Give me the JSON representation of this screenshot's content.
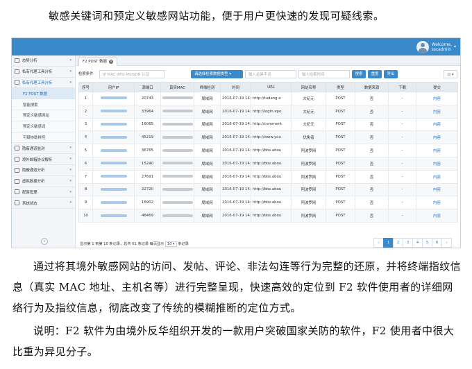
{
  "doc": {
    "para_top": "敏感关键词和预定义敏感网站功能，便于用户更快速的发现可疑线索。",
    "para_mid": "通过将其境外敏感网站的访问、发帖、评论、非法勾连等行为完整的还原，并将终端指纹信息（真实 MAC 地址、主机名等）进行完整呈现，快速高效的定位到 F2 软件使用者的详细网络行为及指纹信息，彻底改变了传统的模糊推断的定位方式。",
    "para_note": "说明：F2 软件为由境外反华组织开发的一款用户突破国家关防的软件，F2 使用者中很大比重为异见分子。"
  },
  "ui": {
    "user": {
      "line1": "Welcome,",
      "line2": "sscadmin"
    },
    "sidebar": [
      {
        "label": "态势分析",
        "type": "top"
      },
      {
        "label": "私有代理工具分析",
        "type": "top"
      },
      {
        "label": "私有代理工具分析",
        "type": "expanded"
      },
      {
        "label": "F2 POST 数据",
        "type": "active"
      },
      {
        "label": "智能搜索",
        "type": "sub"
      },
      {
        "label": "预定义敏感网站",
        "type": "sub"
      },
      {
        "label": "预定义敏感词",
        "type": "sub"
      },
      {
        "label": "可疑协助排控",
        "type": "sub"
      },
      {
        "label": "隐蔽通道监测",
        "type": "top"
      },
      {
        "label": "境外邮箱协议解析",
        "type": "top"
      },
      {
        "label": "隐蔽通道分析",
        "type": "top"
      },
      {
        "label": "虚拟数据分析",
        "type": "top"
      },
      {
        "label": "配置管理",
        "type": "top"
      },
      {
        "label": "系统状态",
        "type": "top"
      }
    ],
    "tab": "F2 POST 数据",
    "filters": {
      "label": "检索条件",
      "ip_placeholder": "IP MAC IMSI MSISDN 认证",
      "select": "请选择检索数据类型",
      "kw_placeholder": "输入关键字词",
      "time_placeholder": "输入检索时间",
      "search": "搜索",
      "reset": "重置",
      "export": "导出",
      "gear": "☷ ▾"
    },
    "headers": [
      "序号",
      "用户IP",
      "源端口",
      "真实MAC",
      "终端检测",
      "时间",
      "URL",
      "网站名称",
      "类型",
      "数据来源",
      "下载",
      "提交"
    ],
    "rows": [
      [
        "1",
        "20743",
        "局域网",
        "2016-07-19 14:",
        "http://tudang.e",
        "大纪元",
        "POST",
        "否",
        "-",
        "内容"
      ],
      [
        "2",
        "33964",
        "局域网",
        "2016-07-19 14:",
        "http://login.epo",
        "大纪元",
        "POST",
        "否",
        "-",
        "内容"
      ],
      [
        "3",
        "16065",
        "局域网",
        "2016-07-19 14:",
        "http://comment",
        "大纪元",
        "POST",
        "否",
        "-",
        "内容"
      ],
      [
        "4",
        "45219",
        "局域网",
        "2016-07-19 14:",
        "http://www.you",
        "优兔者",
        "POST",
        "否",
        "-",
        "内容"
      ],
      [
        "5",
        "36765",
        "局域网",
        "2016-07-19 14:",
        "http://bbs.abou",
        "阿波罗网",
        "POST",
        "否",
        "-",
        "内容"
      ],
      [
        "6",
        "15240",
        "局域网",
        "2016-07-19 14:",
        "http://bbs.abou",
        "阿波罗网",
        "POST",
        "否",
        "-",
        "内容"
      ],
      [
        "7",
        "27691",
        "局域网",
        "2016-07-19 14:",
        "http://bbs.abou",
        "阿波罗网",
        "POST",
        "否",
        "-",
        "内容"
      ],
      [
        "8",
        "22720",
        "局域网",
        "2016-07-19 14:",
        "http://bbs.abou",
        "阿波罗网",
        "POST",
        "否",
        "-",
        "内容"
      ],
      [
        "9",
        "16902",
        "局域网",
        "2016-07-19 14:",
        "http://bbs.abou",
        "阿波罗网",
        "POST",
        "否",
        "-",
        "内容"
      ],
      [
        "10",
        "48469",
        "局域网",
        "2016-07-19 14:",
        "http://bbs.abou",
        "阿波罗网",
        "POST",
        "否",
        "-",
        "内容"
      ]
    ],
    "footer": {
      "text": "显示第 1 到第 10 条记录，总共 61 条记录 每页显示",
      "page_size": "10 ▾",
      "suffix": "条记录",
      "pages": [
        "‹",
        "1",
        "2",
        "3",
        "4",
        "5",
        "6",
        "›"
      ]
    },
    "colors": {
      "accent": "#3a89c9"
    }
  }
}
